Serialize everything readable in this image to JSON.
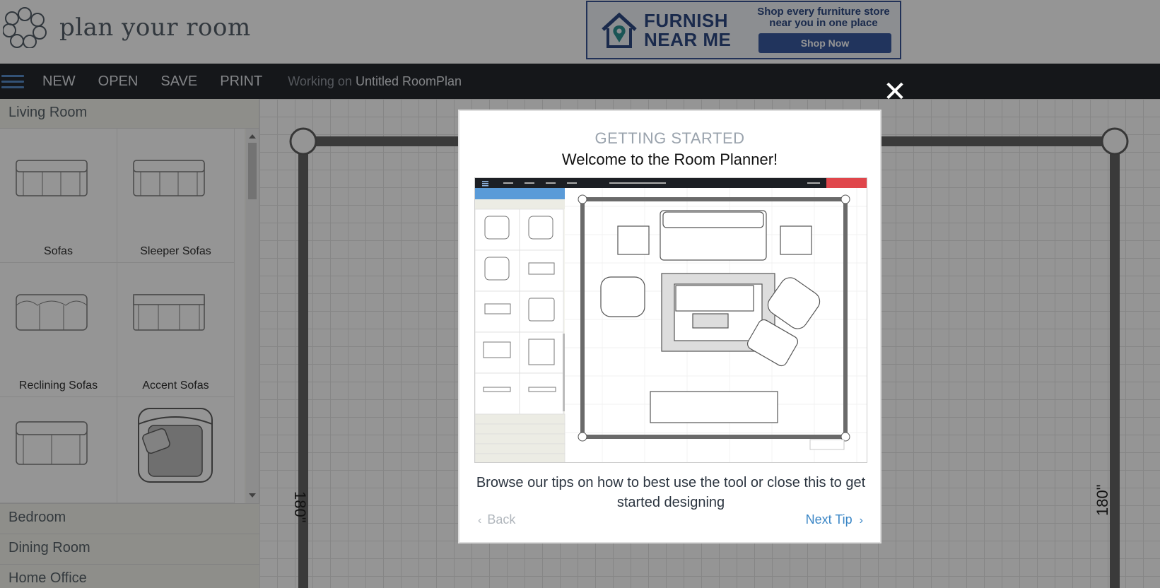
{
  "header": {
    "logo_text": "plan your room",
    "ad": {
      "brand_line1": "FURNISH",
      "brand_line2": "NEAR ME",
      "tagline": "Shop every furniture store near you in one place",
      "cta": "Shop Now"
    }
  },
  "nav": {
    "items": [
      {
        "label": "NEW"
      },
      {
        "label": "OPEN"
      },
      {
        "label": "SAVE"
      },
      {
        "label": "PRINT"
      }
    ],
    "working_prefix": "Working on",
    "document_name": "Untitled RoomPlan"
  },
  "sidebar": {
    "active_category": "Living Room",
    "items": [
      {
        "label": "Sofas"
      },
      {
        "label": "Sleeper Sofas"
      },
      {
        "label": "Reclining Sofas"
      },
      {
        "label": "Accent Sofas"
      },
      {
        "label": ""
      },
      {
        "label": ""
      }
    ],
    "categories": [
      "Bedroom",
      "Dining Room",
      "Home Office"
    ]
  },
  "canvas": {
    "left_dimension": "180\"",
    "right_dimension": "180\""
  },
  "modal": {
    "title": "GETTING STARTED",
    "subtitle": "Welcome to the Room Planner!",
    "description": "Browse our tips on how to best use the tool or close this to get started designing",
    "back_label": "Back",
    "next_label": "Next Tip",
    "close_glyph": "✕"
  },
  "colors": {
    "nav_bg": "#171a1f",
    "accent_blue": "#3a86c6",
    "wall": "#5a5a5a"
  }
}
